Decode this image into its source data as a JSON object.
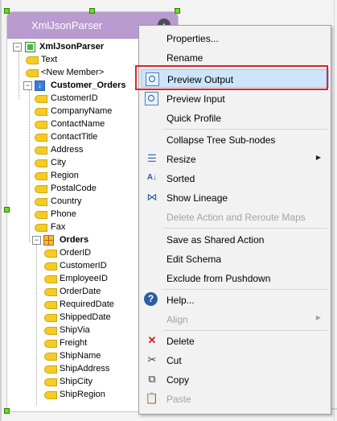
{
  "node": {
    "title": "XmlJsonParser",
    "collapse_glyph": "▲"
  },
  "tree": {
    "root": "XmlJsonParser",
    "items": [
      {
        "label": "Text"
      },
      {
        "label": "<New Member>"
      },
      {
        "label": "Customer_Orders"
      },
      {
        "label": "CustomerID"
      },
      {
        "label": "CompanyName"
      },
      {
        "label": "ContactName"
      },
      {
        "label": "ContactTitle"
      },
      {
        "label": "Address"
      },
      {
        "label": "City"
      },
      {
        "label": "Region"
      },
      {
        "label": "PostalCode"
      },
      {
        "label": "Country"
      },
      {
        "label": "Phone"
      },
      {
        "label": "Fax"
      },
      {
        "label": "Orders"
      },
      {
        "label": "OrderID"
      },
      {
        "label": "CustomerID"
      },
      {
        "label": "EmployeeID"
      },
      {
        "label": "OrderDate"
      },
      {
        "label": "RequiredDate"
      },
      {
        "label": "ShippedDate"
      },
      {
        "label": "ShipVia"
      },
      {
        "label": "Freight"
      },
      {
        "label": "ShipName"
      },
      {
        "label": "ShipAddress"
      },
      {
        "label": "ShipCity"
      },
      {
        "label": "ShipRegion"
      }
    ]
  },
  "menu": {
    "items": [
      {
        "label": "Properties..."
      },
      {
        "label": "Rename"
      },
      {
        "label": "Preview Output"
      },
      {
        "label": "Preview Input"
      },
      {
        "label": "Quick Profile"
      },
      {
        "label": "Collapse Tree Sub-nodes"
      },
      {
        "label": "Resize"
      },
      {
        "label": "Sorted"
      },
      {
        "label": "Show Lineage"
      },
      {
        "label": "Delete Action and Reroute Maps"
      },
      {
        "label": "Save as Shared Action"
      },
      {
        "label": "Edit Schema"
      },
      {
        "label": "Exclude from Pushdown"
      },
      {
        "label": "Help..."
      },
      {
        "label": "Align"
      },
      {
        "label": "Delete"
      },
      {
        "label": "Cut"
      },
      {
        "label": "Copy"
      },
      {
        "label": "Paste"
      }
    ],
    "submenu_arrow": "▶",
    "highlight_color": "#cde5fa",
    "annotation_color": "#e0232b"
  }
}
